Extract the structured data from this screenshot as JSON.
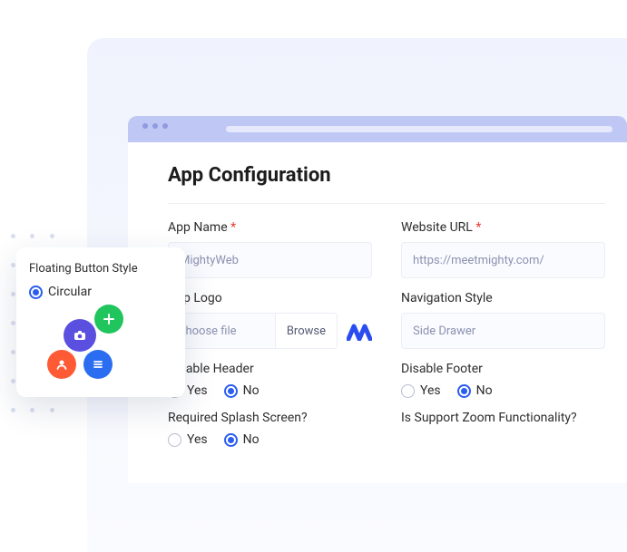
{
  "panel": {
    "title": "App Configuration"
  },
  "fields": {
    "appName": {
      "label": "App Name",
      "value": "MightyWeb"
    },
    "websiteUrl": {
      "label": "Website URL",
      "value": "https://meetmighty.com/"
    },
    "appLogo": {
      "label": "App Logo",
      "choose": "Choose file",
      "browse": "Browse"
    },
    "navStyle": {
      "label": "Navigation Style",
      "value": "Side Drawer"
    },
    "disableHeader": {
      "label": "Disable Header",
      "yes": "Yes",
      "no": "No",
      "selected": "No"
    },
    "disableFooter": {
      "label": "Disable Footer",
      "yes": "Yes",
      "no": "No",
      "selected": "No"
    },
    "splash": {
      "label": "Required Splash Screen?",
      "yes": "Yes",
      "no": "No",
      "selected": "No"
    },
    "zoom": {
      "label": "Is Support Zoom Functionality?"
    }
  },
  "floating": {
    "title": "Floating Button Style",
    "option": "Circular"
  },
  "required_mark": "*"
}
